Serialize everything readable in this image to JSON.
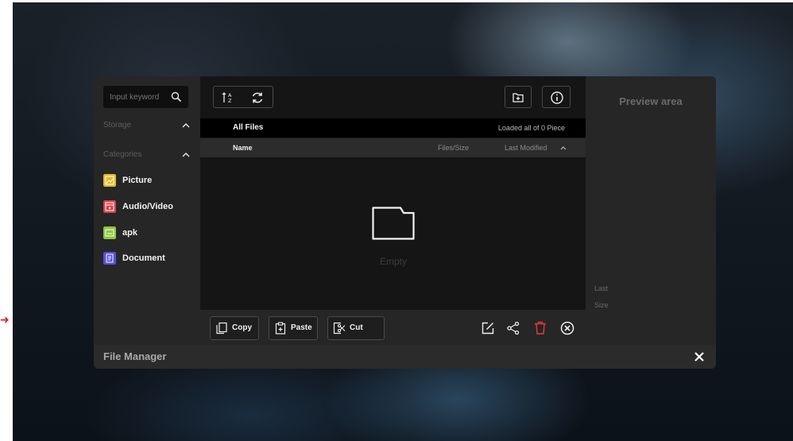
{
  "window": {
    "title": "File Manager"
  },
  "sidebar": {
    "search": {
      "placeholder": "Input keyword",
      "icon": "search-icon"
    },
    "storage_label": "Storage",
    "categories_label": "Categories",
    "categories": [
      {
        "label": "Picture",
        "icon": "picture-icon",
        "color": "#e5b82a"
      },
      {
        "label": "Audio/Video",
        "icon": "audio-video-icon",
        "color": "#d8404a"
      },
      {
        "label": "apk",
        "icon": "apk-icon",
        "color": "#8cc63f"
      },
      {
        "label": "Document",
        "icon": "document-icon",
        "color": "#5a4fd8"
      }
    ]
  },
  "main": {
    "path": "All Files",
    "loaded_status": "Loaded all of 0 Piece",
    "columns": {
      "name": "Name",
      "size": "Files/Size",
      "modified": "Last Modified"
    },
    "empty_label": "Empty",
    "actions": {
      "copy": "Copy",
      "paste": "Paste",
      "cut": "Cut"
    }
  },
  "preview": {
    "title": "Preview area",
    "last_label": "Last",
    "size_label": "Size"
  },
  "colors": {
    "delete": "#e03a3a",
    "panel": "#262626",
    "list_background": "#151515"
  }
}
